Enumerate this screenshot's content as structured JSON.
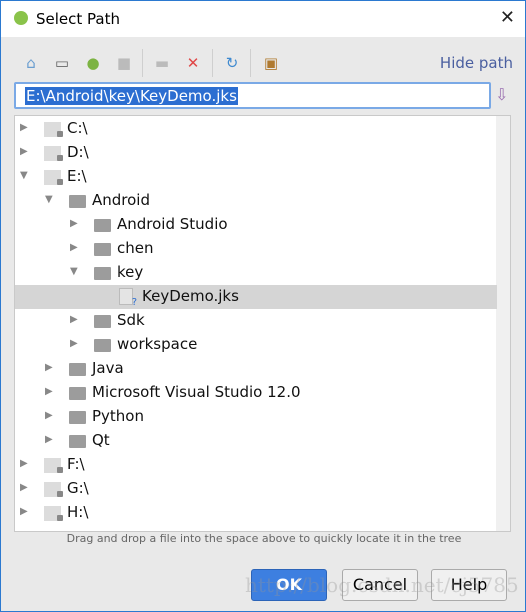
{
  "window": {
    "title": "Select Path",
    "close_icon": "close-icon"
  },
  "toolbar": {
    "icons": [
      "home-icon",
      "desktop-icon",
      "android-project-icon",
      "module-icon",
      "new-folder-icon",
      "delete-icon",
      "refresh-icon",
      "show-hidden-icon"
    ],
    "hide_path": "Hide path"
  },
  "path_field": {
    "value": "E:\\Android\\key\\KeyDemo.jks"
  },
  "tree": [
    {
      "label": "C:\\",
      "level": 0,
      "type": "drive",
      "state": "collapsed"
    },
    {
      "label": "D:\\",
      "level": 0,
      "type": "drive",
      "state": "collapsed"
    },
    {
      "label": "E:\\",
      "level": 0,
      "type": "drive",
      "state": "expanded"
    },
    {
      "label": "Android",
      "level": 1,
      "type": "folder",
      "state": "expanded"
    },
    {
      "label": "Android Studio",
      "level": 2,
      "type": "folder",
      "state": "collapsed"
    },
    {
      "label": "chen",
      "level": 2,
      "type": "folder",
      "state": "collapsed"
    },
    {
      "label": "key",
      "level": 2,
      "type": "folder",
      "state": "expanded"
    },
    {
      "label": "KeyDemo.jks",
      "level": 3,
      "type": "file",
      "selected": true
    },
    {
      "label": "Sdk",
      "level": 2,
      "type": "folder",
      "state": "collapsed"
    },
    {
      "label": "workspace",
      "level": 2,
      "type": "folder",
      "state": "collapsed"
    },
    {
      "label": "Java",
      "level": 1,
      "type": "folder",
      "state": "collapsed"
    },
    {
      "label": "Microsoft Visual Studio 12.0",
      "level": 1,
      "type": "folder",
      "state": "collapsed"
    },
    {
      "label": "Python",
      "level": 1,
      "type": "folder",
      "state": "collapsed"
    },
    {
      "label": "Qt",
      "level": 1,
      "type": "folder",
      "state": "collapsed"
    },
    {
      "label": "F:\\",
      "level": 0,
      "type": "drive",
      "state": "collapsed"
    },
    {
      "label": "G:\\",
      "level": 0,
      "type": "drive",
      "state": "collapsed"
    },
    {
      "label": "H:\\",
      "level": 0,
      "type": "drive",
      "state": "collapsed"
    }
  ],
  "hint": "Drag and drop a file into the space above to quickly locate it in the tree",
  "buttons": {
    "ok": "OK",
    "cancel": "Cancel",
    "help": "Help"
  },
  "watermark": "http://blog.csdn.net/cj5785"
}
